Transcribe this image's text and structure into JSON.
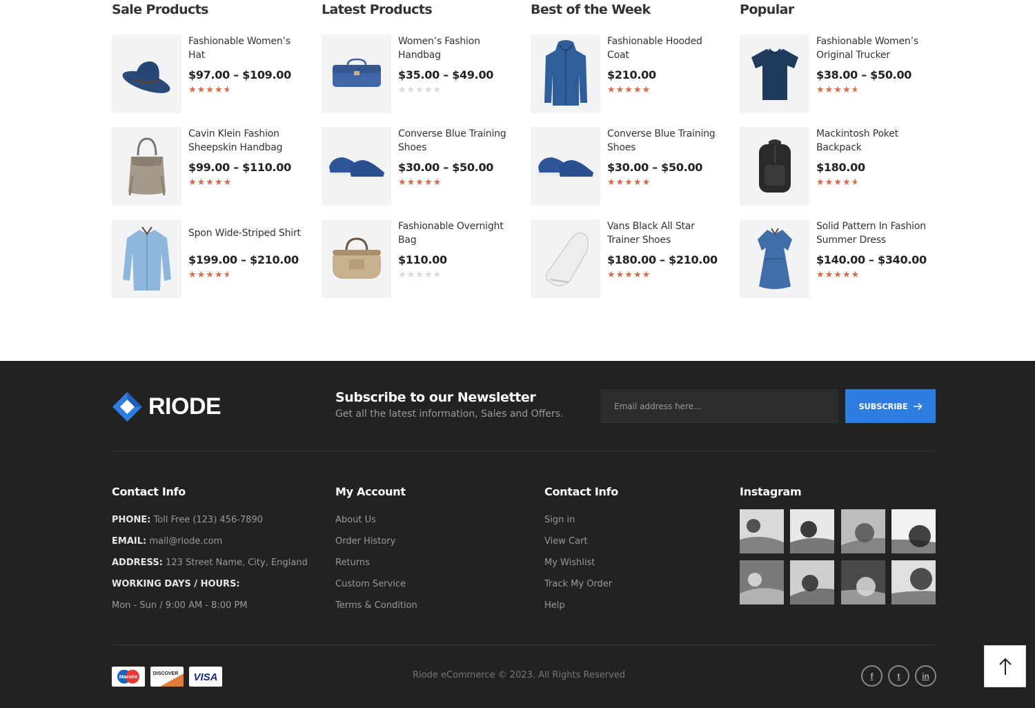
{
  "columns": [
    {
      "title": "Sale Products",
      "items": [
        {
          "name": "Fashionable Women’s Hat",
          "price": "$97.00 – $109.00",
          "rating": 4,
          "image": "hat"
        },
        {
          "name": "Cavin Klein Fashion Sheepskin Handbag",
          "price": "$99.00 – $110.00",
          "rating": 4.5,
          "image": "handbag-beige"
        },
        {
          "name": "Spon Wide-Striped Shirt",
          "price": "$199.00 – $210.00",
          "rating": 4,
          "image": "shirt"
        }
      ]
    },
    {
      "title": "Latest Products",
      "items": [
        {
          "name": "Women’s Fashion Handbag",
          "price": "$35.00 – $49.00",
          "rating": 0,
          "image": "handbag-blue"
        },
        {
          "name": "Converse Blue Training Shoes",
          "price": "$30.00 – $50.00",
          "rating": 5,
          "image": "shoes-blue"
        },
        {
          "name": "Fashionable Overnight Bag",
          "price": "$110.00",
          "rating": 0,
          "image": "duffel"
        }
      ]
    },
    {
      "title": "Best of the Week",
      "items": [
        {
          "name": "Fashionable Hooded Coat",
          "price": "$210.00",
          "rating": 5,
          "image": "coat"
        },
        {
          "name": "Converse Blue Training Shoes",
          "price": "$30.00 – $50.00",
          "rating": 5,
          "image": "shoes-blue"
        },
        {
          "name": "Vans Black All Star Trainer Shoes",
          "price": "$180.00 – $210.00",
          "rating": 5,
          "image": "shoe-white"
        }
      ]
    },
    {
      "title": "Popular",
      "items": [
        {
          "name": "Fashionable Women’s Original Trucker",
          "price": "$38.00 – $50.00",
          "rating": 4,
          "image": "tshirt"
        },
        {
          "name": "Mackintosh Poket Backpack",
          "price": "$180.00",
          "rating": 4,
          "image": "backpack"
        },
        {
          "name": "Solid Pattern In Fashion Summer Dress",
          "price": "$140.00 – $340.00",
          "rating": 4.2,
          "image": "dress"
        }
      ]
    }
  ],
  "footer": {
    "logo_text": "RIODE",
    "newsletter": {
      "title": "Subscribe to our Newsletter",
      "subtitle": "Get all the latest information, Sales and Offers.",
      "placeholder": "Email address here...",
      "button": "SUBSCRIBE"
    },
    "contact": {
      "title": "Contact Info",
      "phone_label": "PHONE:",
      "phone": "Toll Free (123) 456-7890",
      "email_label": "EMAIL:",
      "email": "mail@riode.com",
      "address_label": "ADDRESS:",
      "address": "123 Street Name, City, England",
      "hours_label": "WORKING DAYS / HOURS:",
      "hours": "Mon - Sun / 9:00 AM - 8:00 PM"
    },
    "account": {
      "title": "My Account",
      "links": [
        "About Us",
        "Order History",
        "Returns",
        "Custom Service",
        "Terms & Condition"
      ]
    },
    "contact2": {
      "title": "Contact Info",
      "links": [
        "Sign in",
        "View Cart",
        "My Wishlist",
        "Track My Order",
        "Help"
      ]
    },
    "instagram": {
      "title": "Instagram",
      "photo_count": 8
    },
    "payments": [
      "Maestro",
      "DISCOVER",
      "VISA"
    ],
    "copyright": "Riode eCommerce © 2023. All Rights Reserved",
    "social": [
      {
        "icon": "facebook-icon",
        "glyph": "f"
      },
      {
        "icon": "twitter-icon",
        "glyph": "t"
      },
      {
        "icon": "linkedin-icon",
        "glyph": "in"
      }
    ],
    "accent": "#2e7de0",
    "star_color": "#d26e4b"
  }
}
